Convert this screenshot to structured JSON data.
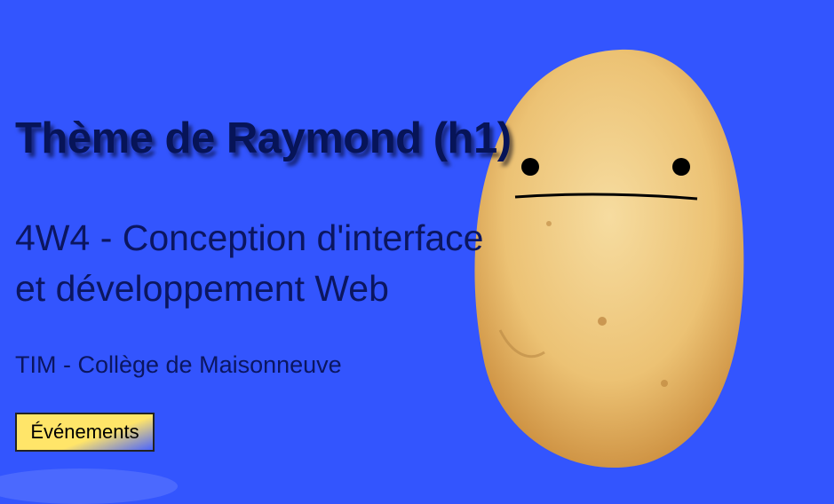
{
  "hero": {
    "title": "Thème de Raymond (h1)",
    "subtitle_line1": "4W4 - Conception d'interface",
    "subtitle_line2": "et développement Web",
    "school": "TIM - Collège de Maisonneuve",
    "button_label": "Événements"
  },
  "colors": {
    "background": "#3355fe",
    "text": "#0b1660",
    "button": "#ffe569"
  }
}
